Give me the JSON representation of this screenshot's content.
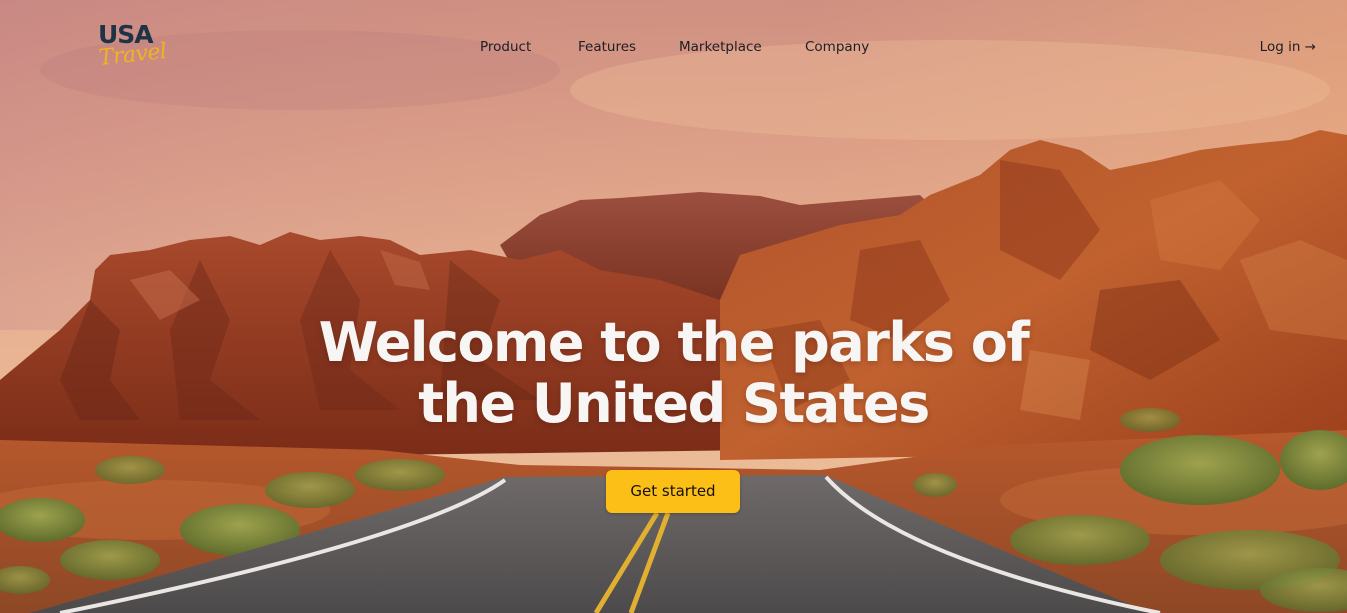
{
  "logo": {
    "line1": "USA",
    "line2": "Travel"
  },
  "nav": {
    "items": [
      {
        "label": "Product"
      },
      {
        "label": "Features"
      },
      {
        "label": "Marketplace"
      },
      {
        "label": "Company"
      }
    ],
    "login_label": "Log in →"
  },
  "hero": {
    "headline_line1": "Welcome to the parks of",
    "headline_line2": "the United States",
    "cta_label": "Get started",
    "background_image": "desert-red-rock-road"
  },
  "colors": {
    "cta_background": "#fbbf17",
    "logo_dark": "#1f3347",
    "logo_accent": "#f0b323",
    "headline_text": "#f8f6f4"
  }
}
